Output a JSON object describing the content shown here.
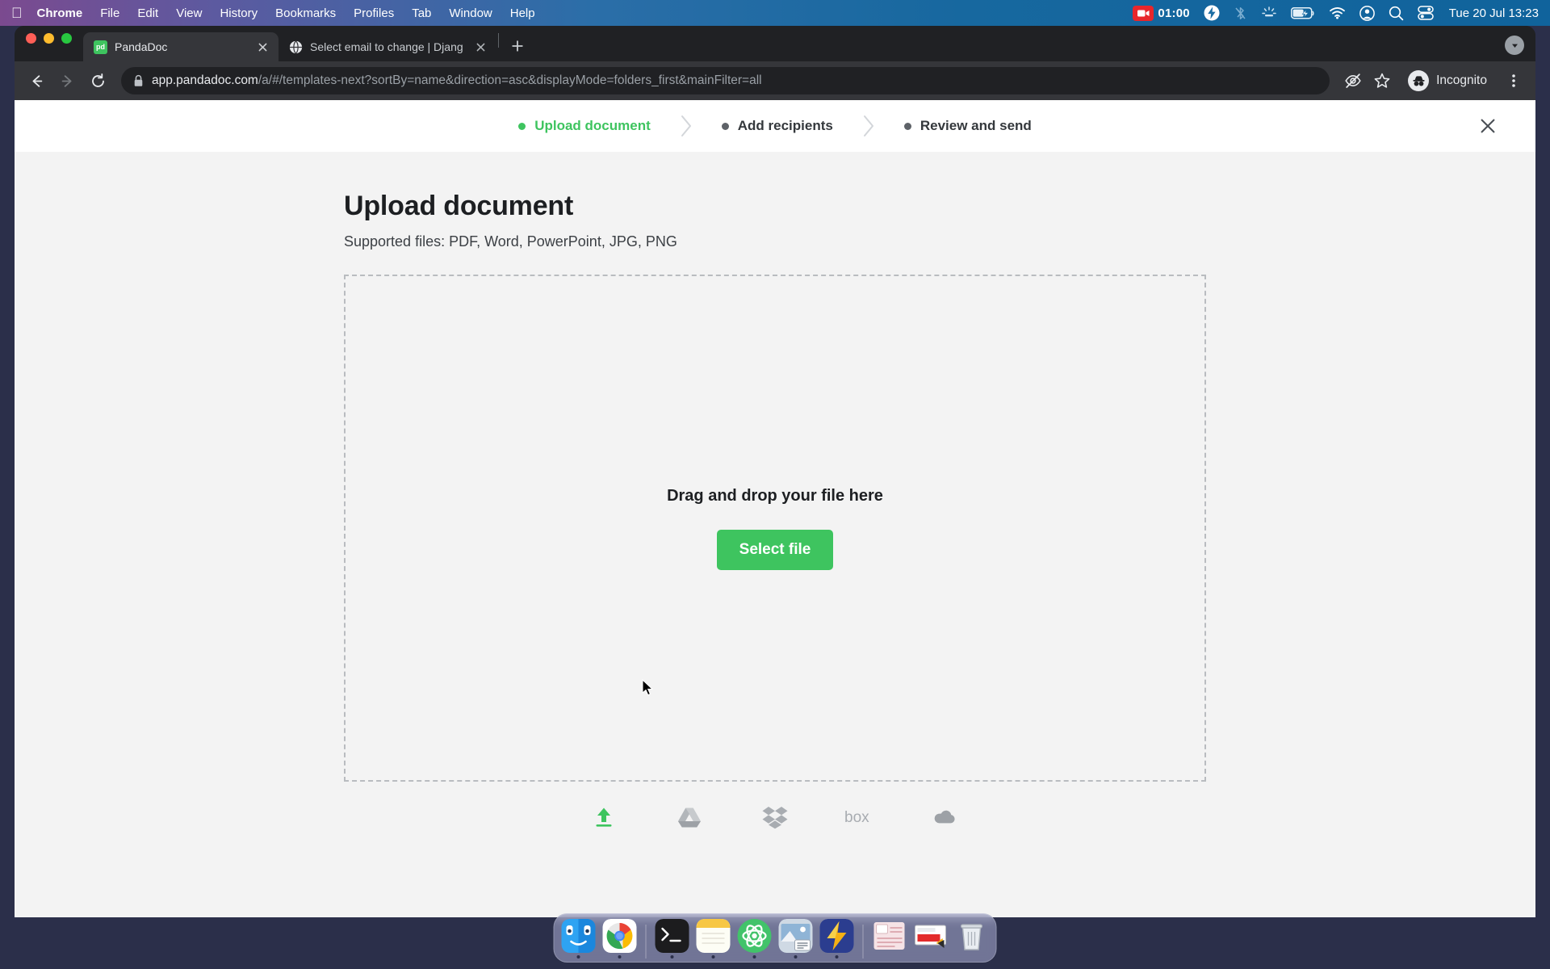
{
  "menubar": {
    "apple_icon": "apple-logo-icon",
    "items": [
      {
        "label": "Chrome",
        "bold": true
      },
      {
        "label": "File",
        "bold": false
      },
      {
        "label": "Edit",
        "bold": false
      },
      {
        "label": "View",
        "bold": false
      },
      {
        "label": "History",
        "bold": false
      },
      {
        "label": "Bookmarks",
        "bold": false
      },
      {
        "label": "Profiles",
        "bold": false
      },
      {
        "label": "Tab",
        "bold": false
      },
      {
        "label": "Window",
        "bold": false
      },
      {
        "label": "Help",
        "bold": false
      }
    ],
    "recording_time": "01:00",
    "status_icons": [
      "screen-recording-icon",
      "flash-icon",
      "bluetooth-off-icon",
      "brightness-icon",
      "battery-charging-icon",
      "wifi-icon",
      "user-account-icon",
      "spotlight-search-icon",
      "control-center-icon"
    ],
    "clock": "Tue 20 Jul  13:23"
  },
  "browser": {
    "tabs": [
      {
        "title": "PandaDoc",
        "favicon": "pandadoc-icon",
        "favicon_text": "pd",
        "active": true
      },
      {
        "title": "Select email to change | Djang",
        "favicon": "globe-icon",
        "favicon_text": "",
        "active": false
      }
    ],
    "new_tab_label": "+",
    "tab_list_icon": "chevron-down-icon",
    "nav": {
      "back_icon": "back-arrow-icon",
      "forward_icon": "forward-arrow-icon",
      "reload_icon": "reload-icon"
    },
    "omnibox": {
      "lock_icon": "lock-icon",
      "host": "app.pandadoc.com",
      "path": "/a/#/templates-next?sortBy=name&direction=asc&displayMode=folders_first&mainFilter=all"
    },
    "toolbar_right": {
      "eye_off_icon": "eye-off-icon",
      "bookmark_icon": "star-icon",
      "profile_label": "Incognito",
      "profile_icon": "incognito-icon",
      "menu_icon": "three-dot-menu-icon"
    }
  },
  "stepper": {
    "steps": [
      {
        "label": "Upload document",
        "state": "active"
      },
      {
        "label": "Add recipients",
        "state": "idle"
      },
      {
        "label": "Review and send",
        "state": "idle"
      }
    ],
    "separator_icon": "chevron-right-icon",
    "close_icon": "close-icon"
  },
  "main": {
    "title": "Upload document",
    "subtitle": "Supported files: PDF, Word, PowerPoint, JPG, PNG",
    "dropzone_text": "Drag and drop your file here",
    "select_file_label": "Select file",
    "sources": [
      {
        "name": "local-upload-icon",
        "label": "Upload",
        "active": true
      },
      {
        "name": "google-drive-icon",
        "label": "Google Drive",
        "active": false
      },
      {
        "name": "dropbox-icon",
        "label": "Dropbox",
        "active": false
      },
      {
        "name": "box-icon",
        "label": "box",
        "active": false
      },
      {
        "name": "onedrive-icon",
        "label": "OneDrive",
        "active": false
      }
    ]
  },
  "dock": {
    "apps": [
      {
        "name": "finder-icon",
        "running": true
      },
      {
        "name": "chrome-icon",
        "running": true
      },
      {
        "name": "terminal-icon",
        "running": true
      },
      {
        "name": "notes-icon",
        "running": true
      },
      {
        "name": "atom-icon",
        "running": true
      },
      {
        "name": "preview-icon",
        "running": true
      },
      {
        "name": "thunder-icon",
        "running": true
      },
      {
        "name": "stickies-icon",
        "running": false
      },
      {
        "name": "keynote-icon",
        "running": false
      },
      {
        "name": "trash-icon",
        "running": false
      }
    ]
  },
  "colors": {
    "accent_green": "#3ec45f",
    "page_bg": "#f3f3f3",
    "chrome_dark": "#202124"
  }
}
